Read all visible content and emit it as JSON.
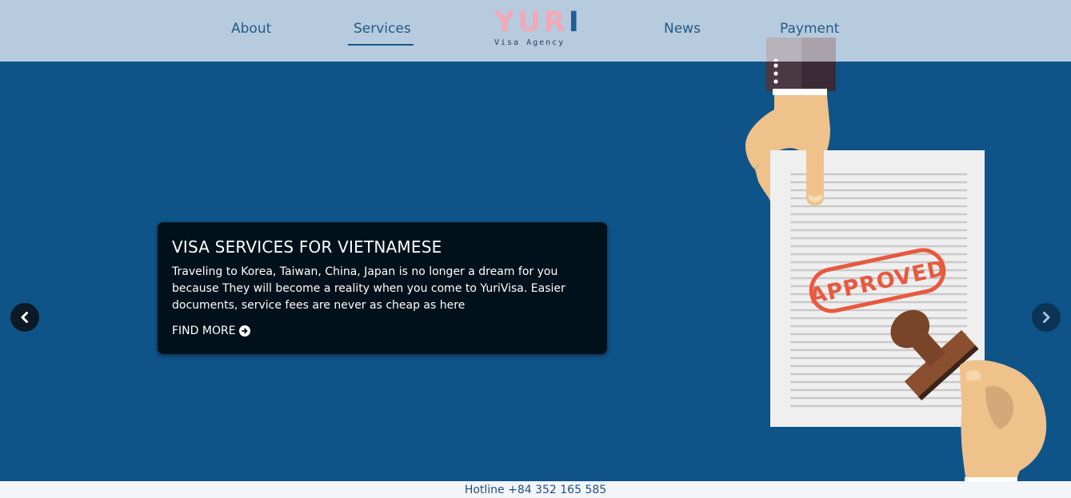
{
  "nav": {
    "items": [
      {
        "label": "About"
      },
      {
        "label": "Services",
        "active": true
      },
      {
        "label": "News"
      },
      {
        "label": "Payment"
      }
    ]
  },
  "logo": {
    "word_part1": "YUR",
    "word_part2": "I",
    "subtitle": "Visa Agency"
  },
  "hero": {
    "title": "VISA SERVICES FOR VIETNAMESE",
    "text": "Traveling to Korea, Taiwan, China, Japan is no longer a dream for you because They will become a reality when you come to YuriVisa. Easier documents, service fees are never as cheap as here",
    "cta_label": "FIND MORE",
    "stamp_text": "APPROVED"
  },
  "footer": {
    "hotline": "Hotline +84 352 165 585"
  },
  "colors": {
    "nav_bg": "#b6cbdd",
    "hero_bg": "#0e5488",
    "caption_bg": "#00111b",
    "logo_pink": "#f3a8b8",
    "logo_blue": "#1f5f97",
    "stamp_red": "#e8593f",
    "paper": "#f0f0f0",
    "skin": "#efc28b"
  },
  "icons": {
    "prev": "chevron-left-icon",
    "next": "chevron-right-icon",
    "cta": "arrow-circle-right-icon"
  }
}
